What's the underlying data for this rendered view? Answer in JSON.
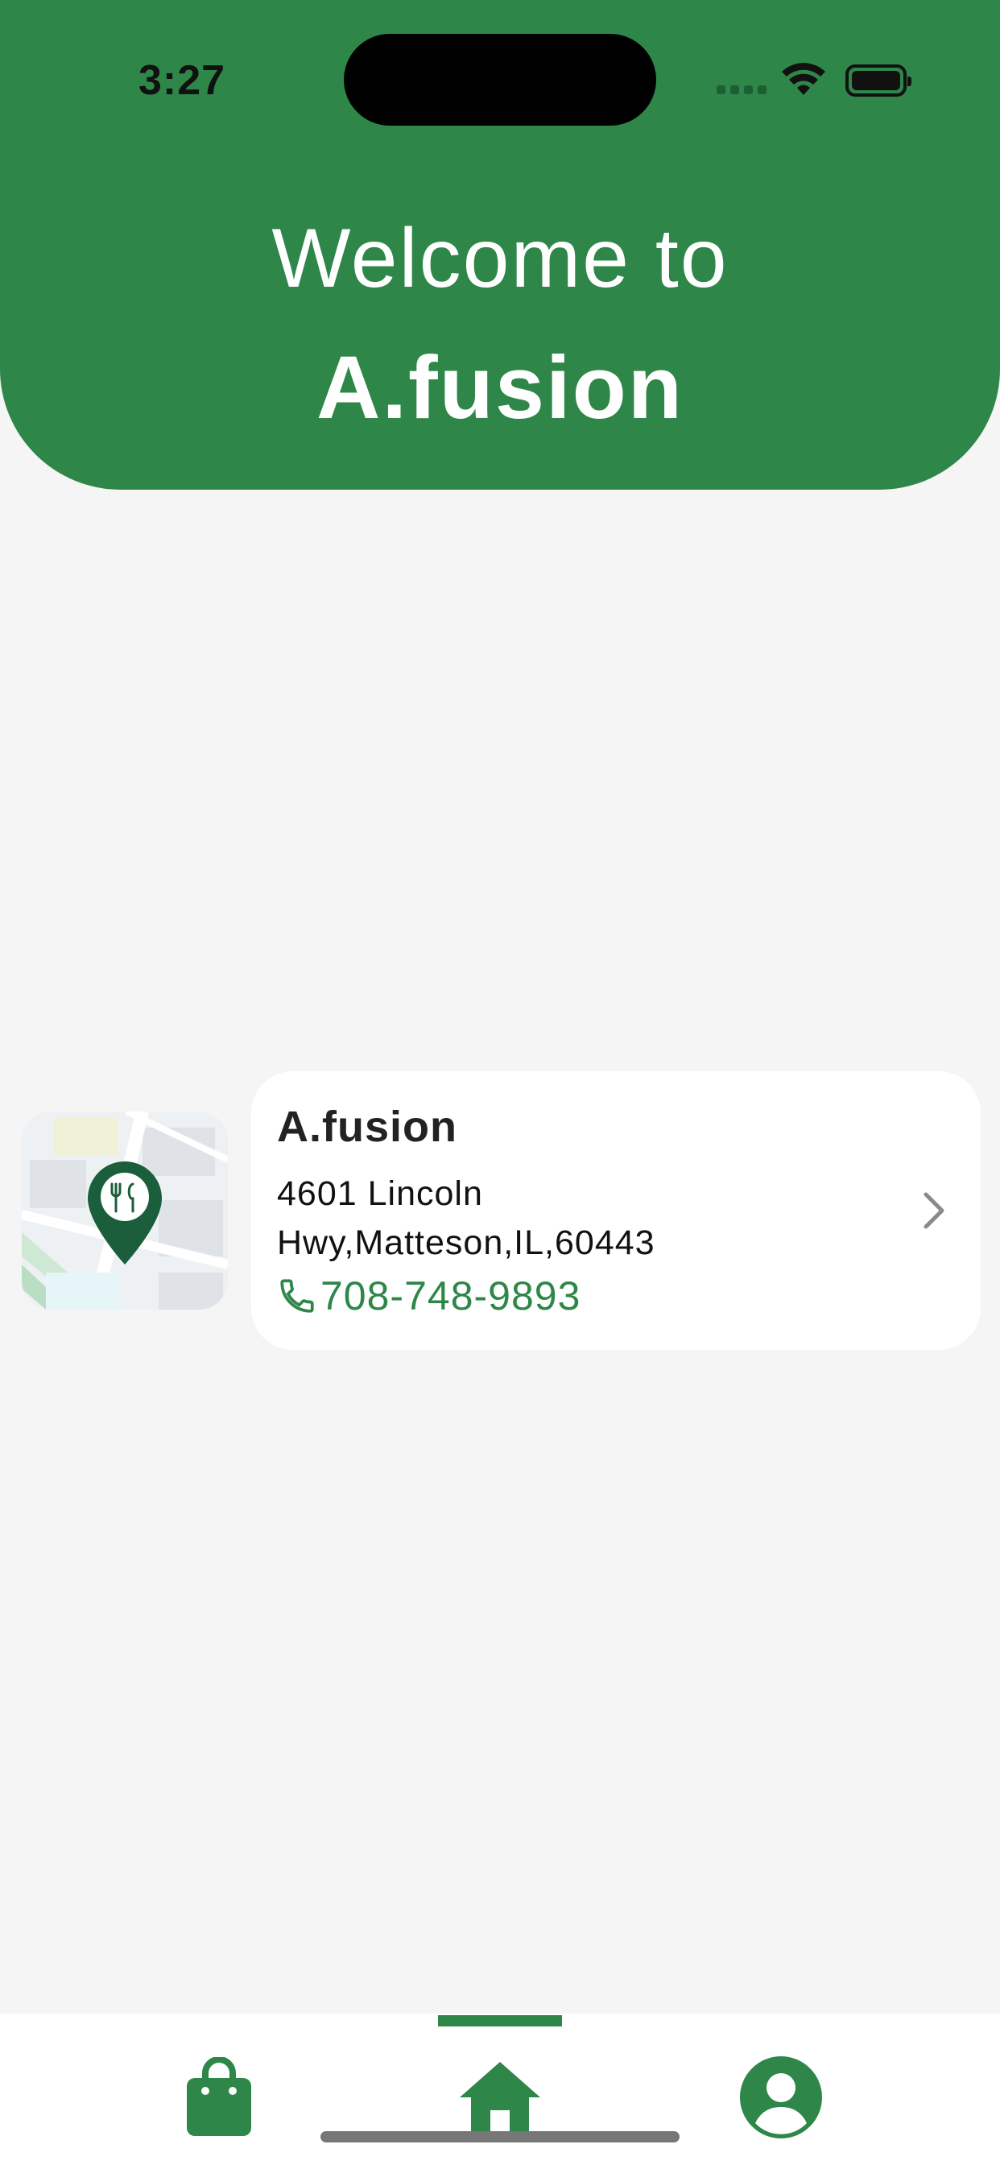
{
  "status_bar": {
    "time": "3:27"
  },
  "header": {
    "welcome": "Welcome to",
    "brand": "A.fusion"
  },
  "restaurant": {
    "name": "A.fusion",
    "address_line1": "4601 Lincoln",
    "address_line2": "Hwy,Matteson,IL,60443",
    "phone": "708-748-9893"
  },
  "icons": {
    "map": "map-pin-fork-knife-icon",
    "phone": "phone-icon",
    "chevron": "chevron-right-icon",
    "nav_orders": "shopping-bag-icon",
    "nav_home": "home-icon",
    "nav_profile": "user-circle-icon"
  },
  "colors": {
    "brand_green": "#2e8749",
    "pin_green": "#1a5e3b",
    "background": "#f5f5f5"
  },
  "bottom_nav": {
    "active": "home"
  }
}
